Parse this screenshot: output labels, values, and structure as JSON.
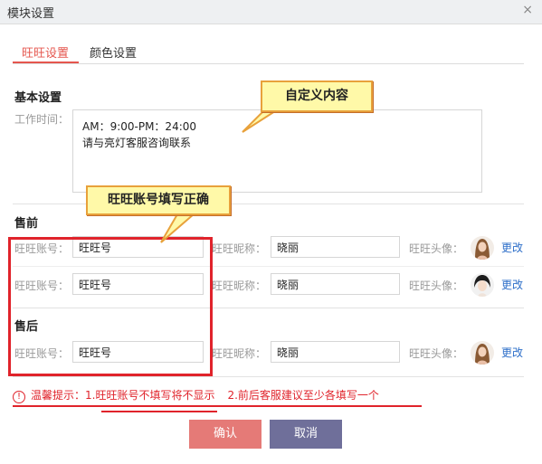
{
  "window": {
    "title": "模块设置",
    "close_symbol": "×"
  },
  "tabs": [
    {
      "label": "旺旺设置",
      "active": true
    },
    {
      "label": "颜色设置",
      "active": false
    }
  ],
  "basic": {
    "title": "基本设置",
    "work_time_label": "工作时间：",
    "work_time_lines": [
      "AM：9:00-PM：24:00",
      "请与亮灯客服咨询联系"
    ]
  },
  "presale": {
    "title": "售前",
    "rows": [
      {
        "account_label": "旺旺账号：",
        "account": "旺旺号",
        "nick_label": "旺旺昵称：",
        "nick": "晓丽",
        "avatar_label": "旺旺头像：",
        "edit": "更改"
      },
      {
        "account_label": "旺旺账号：",
        "account": "旺旺号",
        "nick_label": "旺旺昵称：",
        "nick": "晓丽",
        "avatar_label": "旺旺头像：",
        "edit": "更改"
      }
    ]
  },
  "aftersale": {
    "title": "售后",
    "rows": [
      {
        "account_label": "旺旺账号：",
        "account": "旺旺号",
        "nick_label": "旺旺昵称：",
        "nick": "晓丽",
        "avatar_label": "旺旺头像：",
        "edit": "更改"
      }
    ]
  },
  "annotations": {
    "custom_content": "自定义内容",
    "account_correct": "旺旺账号填写正确"
  },
  "tip": {
    "icon": "!",
    "prefix": "温馨提示：",
    "item1": "1.旺旺账号不填写将不显示",
    "item2": "2.前后客服建议至少各填写一个"
  },
  "buttons": {
    "confirm": "确认",
    "cancel": "取消"
  },
  "colors": {
    "accent": "#e5564e",
    "link": "#2e6fc9",
    "confirm": "#e57a77",
    "cancel": "#6f6f9a",
    "annotation_red": "#e0232b"
  }
}
